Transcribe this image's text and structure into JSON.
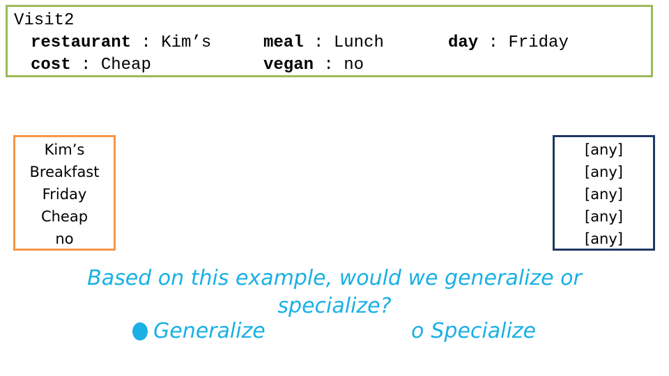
{
  "visit": {
    "title": "Visit2",
    "attributes": [
      {
        "key": "restaurant",
        "value": "Kim’s"
      },
      {
        "key": "meal",
        "value": "Lunch"
      },
      {
        "key": "day",
        "value": "Friday"
      },
      {
        "key": "cost",
        "value": "Cheap"
      },
      {
        "key": "vegan",
        "value": "no"
      }
    ],
    "separator": " : "
  },
  "specific_hypothesis": [
    "Kim’s",
    "Breakfast",
    "Friday",
    "Cheap",
    "no"
  ],
  "general_hypothesis": [
    "[any]",
    "[any]",
    "[any]",
    "[any]",
    "[any]"
  ],
  "question": {
    "line1": "Based on this example, would we generalize or",
    "line2": "specialize?"
  },
  "options": {
    "generalize": {
      "label": "Generalize",
      "selected": true
    },
    "specialize": {
      "label": "Specialize",
      "marker": "o",
      "selected": false
    }
  },
  "colors": {
    "visit_border": "#9bbb59",
    "specific_border": "#f79646",
    "general_border": "#1f3864",
    "question_text": "#1ab0e4"
  }
}
